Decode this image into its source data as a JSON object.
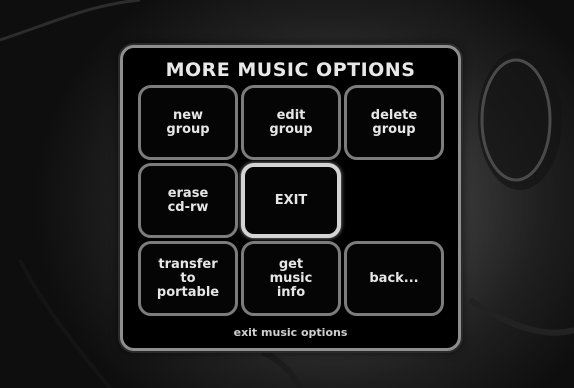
{
  "menu": {
    "title": "MORE MUSIC OPTIONS",
    "buttons": {
      "new_group": "new\ngroup",
      "edit_group": "edit\ngroup",
      "delete_group": "delete\ngroup",
      "erase_cdrw": "erase\ncd-rw",
      "exit": "EXIT",
      "transfer": "transfer\nto\nportable",
      "get_music_info": "get\nmusic\ninfo",
      "back": "back..."
    },
    "selected": "exit",
    "hint": "exit music options"
  },
  "colors": {
    "panel_border": "#8e8e8e",
    "button_border": "#7c7c7c",
    "selected_border": "#d4d4d4",
    "text": "#e6e6e6"
  }
}
